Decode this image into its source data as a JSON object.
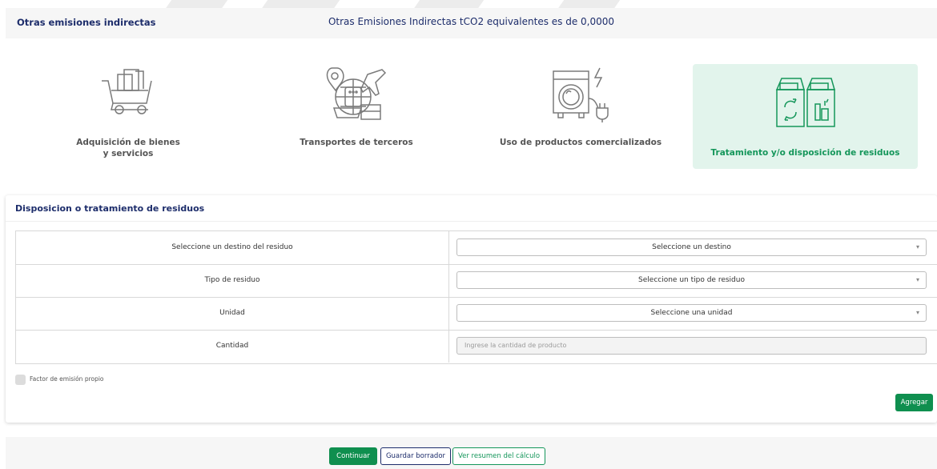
{
  "header": {
    "title": "Otras emisiones indirectas",
    "summary": "Otras Emisiones Indirectas tCO2 equivalentes es de 0,0000"
  },
  "categories": [
    {
      "label": "Adquisición de bienes y servicios",
      "icon": "shopping-cart-icon"
    },
    {
      "label": "Transportes de terceros",
      "icon": "transport-icon"
    },
    {
      "label": "Uso de productos comercializados",
      "icon": "washing-machine-icon"
    },
    {
      "label": "Tratamiento y/o disposición de residuos",
      "icon": "recycling-bins-icon",
      "selected": true
    }
  ],
  "section": {
    "title": "Disposicion o tratamiento de residuos",
    "rows": [
      {
        "label": "Seleccione un destino del residuo",
        "value": "Seleccione un destino"
      },
      {
        "label": "Tipo de residuo",
        "value": "Seleccione un tipo de residuo"
      },
      {
        "label": "Unidad",
        "value": "Seleccione una unidad"
      },
      {
        "label": "Cantidad",
        "placeholder": "Ingrese la cantidad de producto"
      }
    ],
    "checkbox_label": "Factor de emisión propio",
    "add_button": "Agregar"
  },
  "footer": {
    "continue": "Continuar",
    "save_draft": "Guardar borrador",
    "view_summary": "Ver resumen del cálculo"
  },
  "colors": {
    "navy": "#1d2d6b",
    "green": "#0f8f4f",
    "selected_bg": "#e2f4ec",
    "icon_grey": "#7a7a7a"
  }
}
